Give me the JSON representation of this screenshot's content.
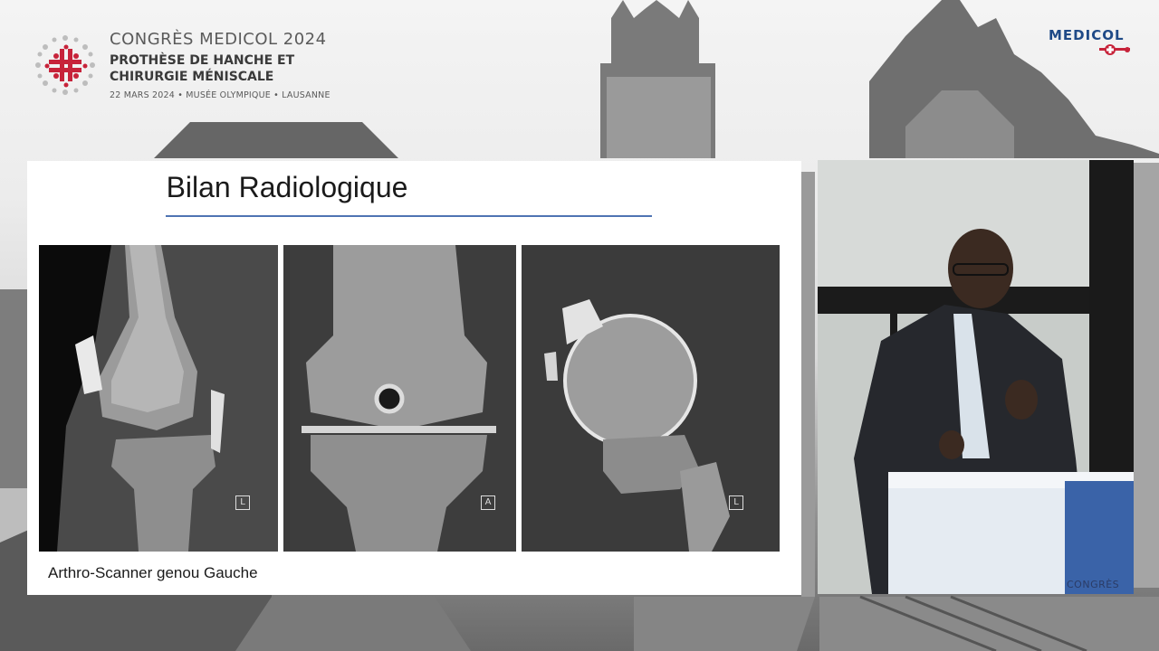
{
  "header": {
    "congres_title": "CONGRÈS MEDICOL 2024",
    "subtitle_line1": "PROTHÈSE DE HANCHE ET",
    "subtitle_line2": "CHIRURGIE MÉNISCALE",
    "date_venue": "22 MARS 2024 • MUSÉE OLYMPIQUE • LAUSANNE",
    "brand_name": "MEDICOL"
  },
  "slide": {
    "title": "Bilan Radiologique",
    "caption": "Arthro-Scanner genou Gauche",
    "scans": [
      {
        "orientation_marker": "L"
      },
      {
        "orientation_marker": "A"
      },
      {
        "orientation_marker": "L"
      }
    ]
  },
  "speaker": {
    "podium_text": "CONGRÈS"
  },
  "colors": {
    "title_rule": "#4f74b3",
    "brand_blue": "#1f4a87",
    "brand_red": "#c7233a",
    "logo_red": "#c7233a"
  }
}
